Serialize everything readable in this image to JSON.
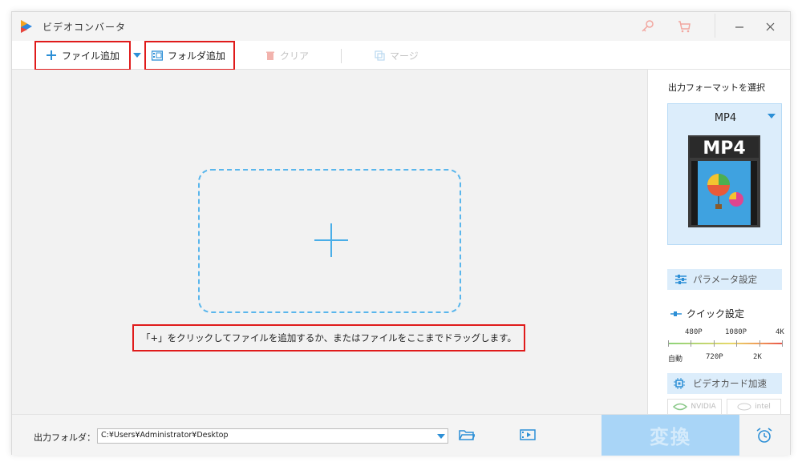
{
  "app": {
    "title": "ビデオコンバータ"
  },
  "titlebar": {
    "icons": [
      "key-icon",
      "cart-icon",
      "minimize-icon",
      "close-icon"
    ],
    "minimize_label": "—",
    "close_label": "✕"
  },
  "toolbar": {
    "add_file": "ファイル追加",
    "add_folder": "フォルダ追加",
    "clear": "クリア",
    "merge": "マージ"
  },
  "main": {
    "hint": "「+」をクリックしてファイルを追加するか、またはファイルをここまでドラッグします。"
  },
  "panel": {
    "title": "出力フォーマットを選択",
    "format": "MP4",
    "format_thumb_label": "MP4",
    "params": "パラメータ設定",
    "quick": "クイック設定",
    "quick_top_labels": [
      "480P",
      "1080P",
      "4K"
    ],
    "quick_bottom_labels": [
      "自動",
      "720P",
      "2K"
    ],
    "gpu": "ビデオカード加速",
    "nvidia": "NVIDIA",
    "intel": "intel"
  },
  "bottom": {
    "output_label": "出力フォルダ：",
    "output_path": "C:¥Users¥Administrator¥Desktop",
    "convert": "変換"
  },
  "colors": {
    "accent": "#2c8fd6",
    "highlight_box": "#e01b1b",
    "convert_bg": "#a9d5f7"
  }
}
